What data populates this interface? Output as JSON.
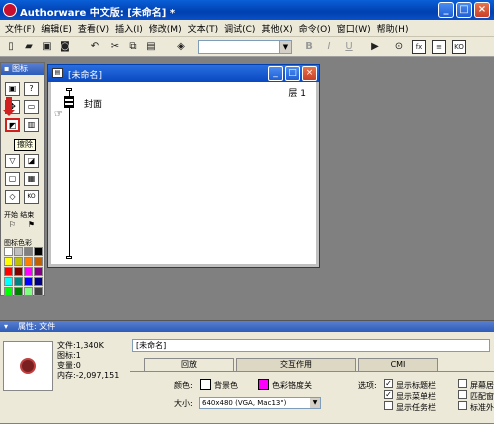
{
  "window": {
    "title": "Authorware 中文版: [未命名] *",
    "min_symbol": "_",
    "max_symbol": "□",
    "close_symbol": "×"
  },
  "menu": [
    "文件(F)",
    "编辑(E)",
    "查看(V)",
    "插入(I)",
    "修改(M)",
    "文本(T)",
    "调试(C)",
    "其他(X)",
    "命令(O)",
    "窗口(W)",
    "帮助(H)"
  ],
  "toolbar": {
    "bold": "B",
    "italic": "I",
    "underline": "U",
    "font_value": ""
  },
  "palette": {
    "title": "图标",
    "tooltip": "擦除",
    "start_label": "开始",
    "end_label": "结束",
    "color_label": "图标色彩",
    "colors": [
      "#ffffff",
      "#c0c0c0",
      "#808080",
      "#000000",
      "#ffff00",
      "#c0c000",
      "#ff8000",
      "#c06000",
      "#ff0000",
      "#800000",
      "#ff00ff",
      "#800080",
      "#00ffff",
      "#008080",
      "#0000ff",
      "#000080",
      "#00ff00",
      "#008000",
      "#80ff80",
      "#404040"
    ]
  },
  "design_window": {
    "title": "[未命名]",
    "layer": "层 1",
    "map_icon_label": "封面"
  },
  "properties": {
    "header": "属性: 文件",
    "info": {
      "file": "文件:1,340K",
      "icons": "图标:1",
      "vars": "变量:0",
      "memory": "内存:-2,097,151"
    },
    "name": "[未命名]",
    "tabs": [
      "回放",
      "交互作用",
      "CMI"
    ],
    "color_label": "颜色:",
    "bg_color_label": "背景色",
    "chroma_label": "色彩铬度关",
    "size_label": "大小:",
    "size_value": "640x480 (VGA, Mac13\")",
    "options_label": "选项:",
    "options": [
      "显示标题栏",
      "显示菜单栏",
      "显示任务栏"
    ],
    "options_right": [
      "屏幕居中",
      "匹配窗口",
      "标准外观"
    ]
  }
}
